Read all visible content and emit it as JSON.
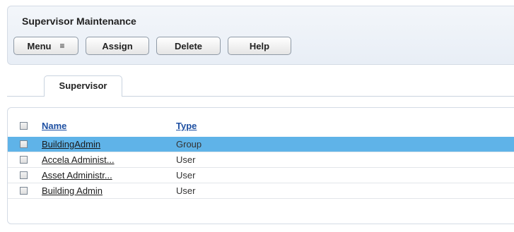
{
  "header": {
    "title": "Supervisor Maintenance"
  },
  "toolbar": {
    "menu_label": "Menu",
    "assign_label": "Assign",
    "delete_label": "Delete",
    "help_label": "Help"
  },
  "tabs": [
    {
      "label": "Supervisor",
      "active": true
    }
  ],
  "grid": {
    "columns": [
      "Name",
      "Type"
    ],
    "rows": [
      {
        "name": "BuildingAdmin",
        "type": "Group",
        "selected": true
      },
      {
        "name": "Accela Administ...",
        "type": "User",
        "selected": false
      },
      {
        "name": "Asset Administr...",
        "type": "User",
        "selected": false
      },
      {
        "name": "Building Admin",
        "type": "User",
        "selected": false
      }
    ]
  },
  "colors": {
    "selected_row": "#5fb3e8",
    "header_link": "#1d4fa2"
  },
  "icons": {
    "menu": "menu-dropdown-icon"
  }
}
